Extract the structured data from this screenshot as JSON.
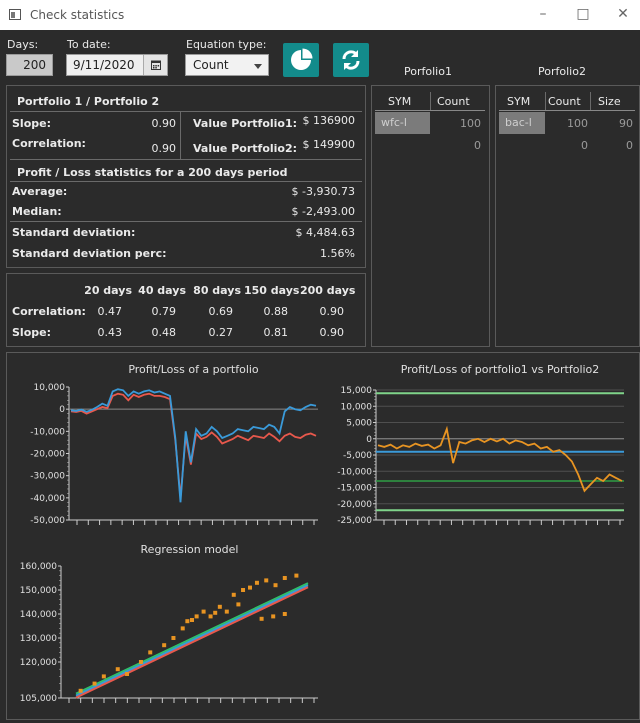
{
  "window": {
    "title": "Check statistics"
  },
  "controls": {
    "days_label": "Days:",
    "days_value": "200",
    "todate_label": "To date:",
    "todate_value": "9/11/2020",
    "equation_label": "Equation type:",
    "equation_value": "Count"
  },
  "stats": {
    "header": "Portfolio 1 / Portfolio 2",
    "slope_label": "Slope:",
    "slope_value": "0.90",
    "correlation_label": "Correlation:",
    "correlation_value": "0.90",
    "value1_label": "Value Portfolio1:",
    "value1": "$ 136900",
    "value2_label": "Value Portfolio2:",
    "value2": "$ 149900",
    "pl_header": "Profit / Loss statistics for a 200 days period",
    "average_label": "Average:",
    "average_value": "$ -3,930.73",
    "median_label": "Median:",
    "median_value": "$ -2,493.00",
    "stddev_label": "Standard deviation:",
    "stddev_value": "$ 4,484.63",
    "stddevperc_label": "Standard deviation perc:",
    "stddevperc_value": "1.56%"
  },
  "period_table": {
    "headers": [
      "20 days",
      "40 days",
      "80 days",
      "150 days",
      "200 days"
    ],
    "correlation_label": "Correlation:",
    "correlation": [
      "0.47",
      "0.79",
      "0.69",
      "0.88",
      "0.90"
    ],
    "slope_label": "Slope:",
    "slope": [
      "0.43",
      "0.48",
      "0.27",
      "0.81",
      "0.90"
    ]
  },
  "portfolio1": {
    "title": "Porfolio1",
    "columns": [
      "SYM",
      "Count"
    ],
    "rows": [
      [
        "wfc-l",
        "100"
      ],
      [
        "",
        "0"
      ]
    ]
  },
  "portfolio2": {
    "title": "Porfolio2",
    "columns": [
      "SYM",
      "Count",
      "Size"
    ],
    "rows": [
      [
        "bac-l",
        "100",
        "90"
      ],
      [
        "",
        "0",
        "0"
      ]
    ]
  },
  "colors": {
    "accent": "#138b8b",
    "series_blue": "#3a9ad9",
    "series_red": "#e8584c",
    "series_orange": "#e89422",
    "series_green": "#2fbf6a"
  },
  "chart_data": [
    {
      "type": "line",
      "title": "Profit/Loss of a portfolio",
      "ylim": [
        -50000,
        10000
      ],
      "yticks": [
        "10,000",
        "0",
        "-10,000",
        "-20,000",
        "-30,000",
        "-40,000",
        "-50,000"
      ],
      "series": [
        {
          "values": [
            -500,
            -800,
            -200,
            -1200,
            -300,
            1000,
            2500,
            1500,
            8000,
            9000,
            8500,
            6000,
            8000,
            7000,
            8000,
            8500,
            7500,
            8000,
            7000,
            6000,
            -13000,
            -42000,
            -10000,
            -24000,
            -9000,
            -12000,
            -11000,
            -8000,
            -10000,
            -13000,
            -12000,
            -11000,
            -9000,
            -9500,
            -10000,
            -8000,
            -8500,
            -9000,
            -7000,
            -8000,
            -11000,
            -1000,
            1000,
            0,
            -500,
            1000,
            2000,
            1500
          ]
        },
        {
          "values": [
            -1000,
            -1300,
            -800,
            -2000,
            -1000,
            0,
            1000,
            500,
            6000,
            7000,
            6500,
            4000,
            6500,
            5500,
            6500,
            7000,
            6000,
            6000,
            5500,
            4500,
            -14000,
            -40000,
            -12000,
            -25000,
            -11000,
            -13500,
            -12500,
            -10500,
            -12500,
            -15500,
            -14500,
            -13500,
            -12000,
            -13000,
            -14000,
            -12000,
            -12500,
            -13000,
            -11000,
            -12500,
            -14500,
            -12000,
            -11000,
            -12500,
            -13000,
            -11500,
            -11000,
            -12000
          ]
        }
      ]
    },
    {
      "type": "line",
      "title": "Profit/Loss of portfolio1 vs Portfolio2",
      "ylim": [
        -25000,
        15000
      ],
      "yticks": [
        "15,000",
        "10,000",
        "5,000",
        "0",
        "-5,000",
        "-10,000",
        "-15,000",
        "-20,000",
        "-25,000"
      ],
      "series": [
        {
          "values": [
            -2000,
            -2500,
            -1800,
            -3000,
            -2000,
            -2500,
            -1500,
            -2200,
            -1800,
            -3000,
            -2000,
            3000,
            -7500,
            -1000,
            -1500,
            -500,
            0,
            -1000,
            0,
            -800,
            0,
            -1500,
            -500,
            -1000,
            -2000,
            -1500,
            -3000,
            -2500,
            -4000,
            -3500,
            -5000,
            -7000,
            -11000,
            -16000,
            -14000,
            -12000,
            -13000,
            -11000,
            -12000,
            -13000
          ]
        }
      ],
      "reference_lines": [
        14000,
        -4000,
        -13000,
        -22000
      ]
    },
    {
      "type": "scatter",
      "title": "Regression model",
      "ylim": [
        105000,
        160000
      ],
      "yticks": [
        "160,000",
        "150,000",
        "140,000",
        "130,000",
        "120,000",
        "105,000"
      ],
      "points": [
        [
          0.02,
          108000
        ],
        [
          0.08,
          111000
        ],
        [
          0.12,
          114000
        ],
        [
          0.18,
          117000
        ],
        [
          0.22,
          115000
        ],
        [
          0.28,
          120000
        ],
        [
          0.32,
          124000
        ],
        [
          0.38,
          127000
        ],
        [
          0.42,
          130000
        ],
        [
          0.46,
          134000
        ],
        [
          0.48,
          137000
        ],
        [
          0.52,
          139000
        ],
        [
          0.55,
          141000
        ],
        [
          0.58,
          139000
        ],
        [
          0.62,
          143000
        ],
        [
          0.65,
          141000
        ],
        [
          0.68,
          148000
        ],
        [
          0.72,
          150000
        ],
        [
          0.75,
          151000
        ],
        [
          0.78,
          153000
        ],
        [
          0.82,
          154000
        ],
        [
          0.86,
          152000
        ],
        [
          0.9,
          155000
        ],
        [
          0.95,
          156000
        ],
        [
          0.8,
          138000
        ],
        [
          0.85,
          139000
        ],
        [
          0.9,
          140000
        ],
        [
          0.7,
          144000
        ],
        [
          0.6,
          140500
        ],
        [
          0.5,
          137500
        ]
      ],
      "fit": [
        [
          0,
          106000
        ],
        [
          1,
          152000
        ]
      ]
    }
  ]
}
